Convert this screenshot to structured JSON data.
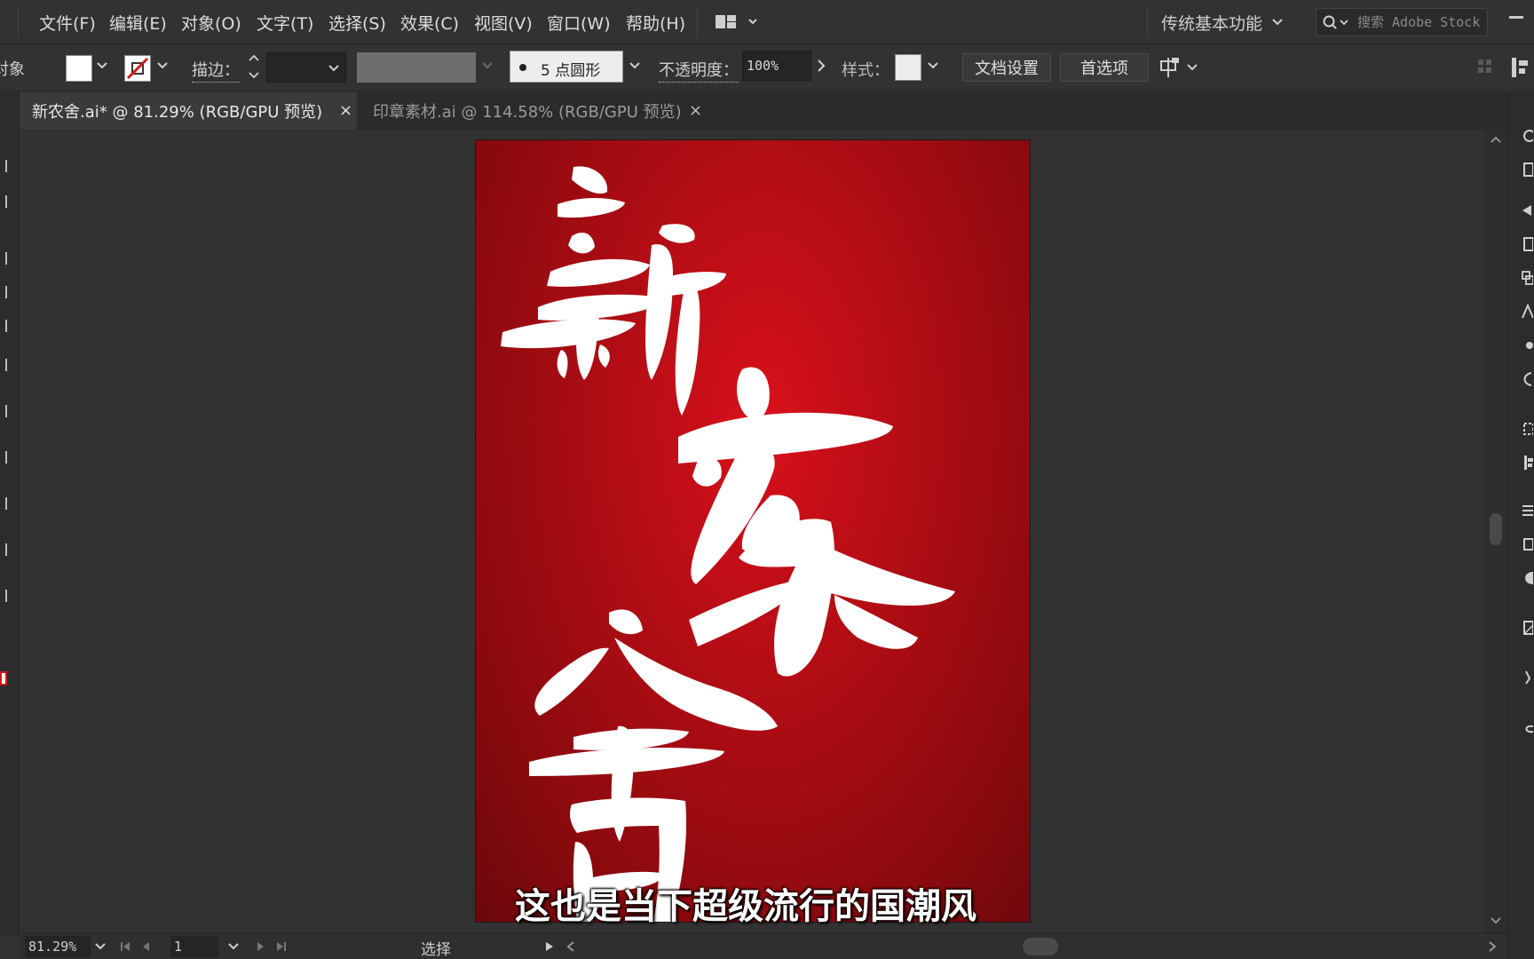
{
  "menu": {
    "items": [
      "文件(F)",
      "编辑(E)",
      "对象(O)",
      "文字(T)",
      "选择(S)",
      "效果(C)",
      "视图(V)",
      "窗口(W)",
      "帮助(H)"
    ],
    "workspace": "传统基本功能",
    "search_placeholder": "搜索 Adobe Stock"
  },
  "control_bar": {
    "selection_label": "对象",
    "stroke_label": "描边：",
    "brush_label": "5 点圆形",
    "opacity_label": "不透明度：",
    "opacity_value": "100%",
    "style_label": "样式：",
    "doc_setup_button": "文档设置",
    "preferences_button": "首选项"
  },
  "tabs": [
    {
      "label": "新农舍.ai* @ 81.29% (RGB/GPU 预览)",
      "close": "×"
    },
    {
      "label": "印章素材.ai @ 114.58% (RGB/GPU 预览)",
      "close": "×"
    }
  ],
  "artboard": {
    "background_color_center": "#d9101a",
    "background_color_edge": "#6b080b",
    "artwork": "brush calligraphy 新农舍",
    "subtitle": "这也是当下超级流行的国潮风"
  },
  "status_bar": {
    "zoom": "81.29%",
    "page": "1",
    "current_tool": "选择"
  },
  "colors": {
    "ui_bg": "#323232",
    "panel_bg": "#2c2c2c",
    "accent_red": "#cc1a1a"
  }
}
